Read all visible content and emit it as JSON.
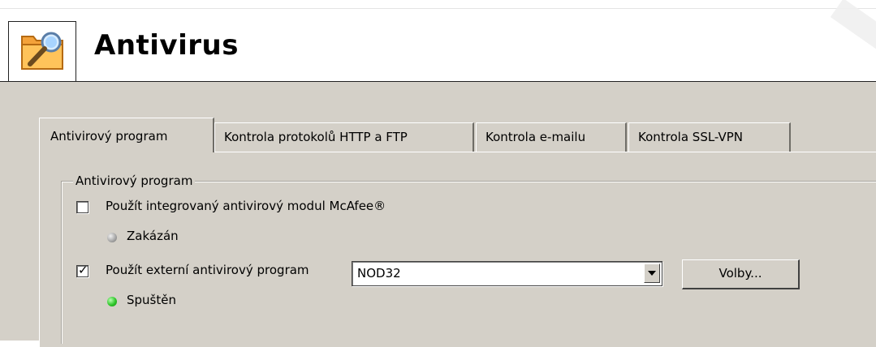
{
  "header": {
    "title": "Antivirus",
    "icon": "folder-magnifier-icon"
  },
  "tabs": [
    {
      "label": "Antivirový program",
      "active": true
    },
    {
      "label": "Kontrola protokolů HTTP a FTP",
      "active": false
    },
    {
      "label": "Kontrola e-mailu",
      "active": false
    },
    {
      "label": "Kontrola SSL-VPN",
      "active": false
    }
  ],
  "group": {
    "legend": "Antivirový program",
    "integrated": {
      "checkbox_label": "Použít integrovaný antivirový modul McAfee®",
      "checked": false,
      "status_text": "Zakázán",
      "status_color": "#a9a9a9"
    },
    "external": {
      "checkbox_label": "Použít externí antivirový program",
      "checked": true,
      "selected_program": "NOD32",
      "options_button": "Volby...",
      "status_text": "Spuštěn",
      "status_color": "#2ec62a"
    }
  }
}
